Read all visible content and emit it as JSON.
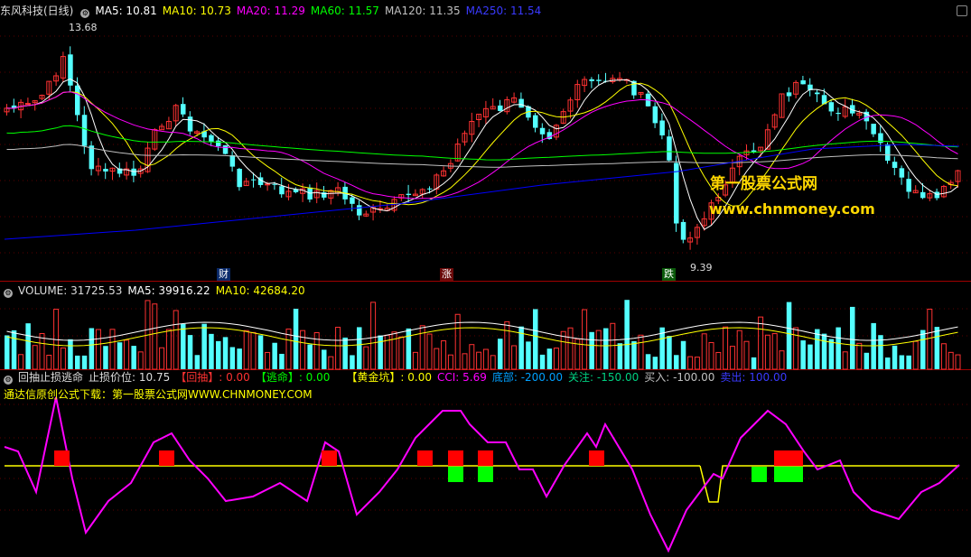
{
  "price_header": {
    "title": "东风科技(日线)",
    "ma5": "MA5: 10.81",
    "ma10": "MA10: 10.73",
    "ma20": "MA20: 11.29",
    "ma60": "MA60: 11.57",
    "ma120": "MA120: 11.35",
    "ma250": "MA250: 11.54"
  },
  "price_labels": {
    "high": "13.68",
    "low": "9.39",
    "marker_cai": "财",
    "marker_zhang": "涨",
    "marker_die": "跌"
  },
  "watermark": {
    "line1": "第一股票公式网",
    "line2": "www.chnmoney.com"
  },
  "volume_header": {
    "volume": "VOLUME: 31725.53",
    "ma5": "MA5: 39916.22",
    "ma10": "MA10: 42684.20"
  },
  "indicator_header": {
    "name": "回抽止损逃命",
    "stop": "止损价位: 10.75",
    "huichou": "【回抽】: 0.00",
    "taoming": "【逃命】: 0.00",
    "huangjin": "【黄金坑】: 0.00",
    "cci": "CCI: 5.69",
    "bottom": "底部: -200.00",
    "attention": "关注: -150.00",
    "buy": "买入: -100.00",
    "sell": "卖出: 100.00",
    "subline": "通达信原创公式下载：第一股票公式网WWW.CHNMONEY.COM"
  },
  "colors": {
    "up": "#ff3232",
    "down": "#54ffff",
    "ma5": "#ffffff",
    "ma10": "#ffff00",
    "ma20": "#ff00ff",
    "ma60": "#00ff00",
    "ma120": "#c0c0c0",
    "ma250": "#0000ff",
    "cci": "#ff00ff",
    "sell_signal": "#ff0000",
    "buy_signal": "#00ff00"
  }
}
